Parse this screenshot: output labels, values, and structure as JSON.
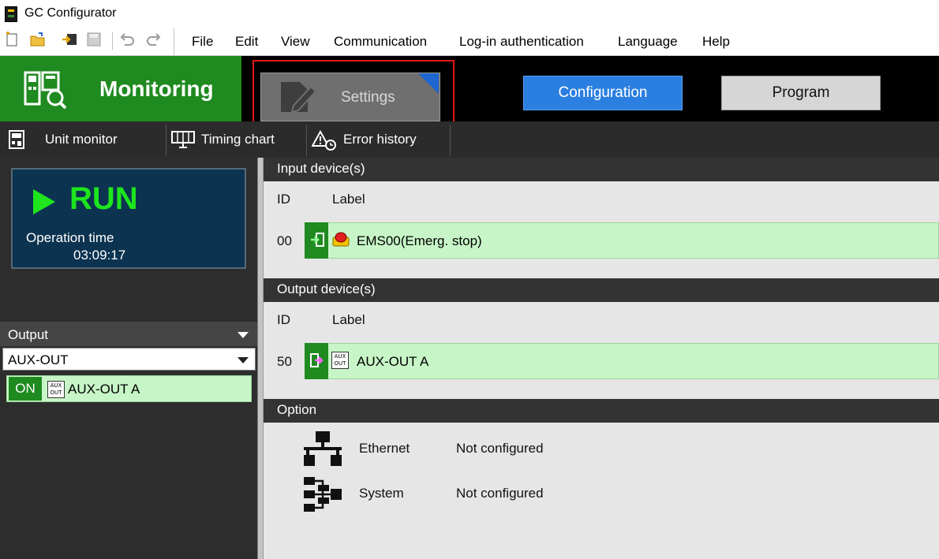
{
  "window": {
    "title": "GC Configurator"
  },
  "menu": {
    "items": [
      "File",
      "Edit",
      "View",
      "Communication",
      "Log-in authentication",
      "Language",
      "Help"
    ]
  },
  "toolbar_icons": [
    "new-file-icon",
    "open-folder-icon",
    "import-icon",
    "save-icon",
    "undo-icon",
    "redo-icon"
  ],
  "top_tabs": {
    "monitoring": "Monitoring",
    "settings": "Settings",
    "configuration": "Configuration",
    "program": "Program"
  },
  "sub_tabs": [
    "Unit monitor",
    "Timing chart",
    "Error history"
  ],
  "status": {
    "state": "RUN",
    "operation_time_label": "Operation time",
    "operation_time": "03:09:17"
  },
  "output_panel": {
    "header": "Output",
    "selected": "AUX-OUT",
    "items": [
      {
        "state": "ON",
        "icon_text": "AUX OUT",
        "label": "AUX-OUT A"
      }
    ]
  },
  "input_devices": {
    "header": "Input device(s)",
    "col_id": "ID",
    "col_label": "Label",
    "rows": [
      {
        "id": "00",
        "label": "EMS00(Emerg. stop)"
      }
    ]
  },
  "output_devices": {
    "header": "Output device(s)",
    "col_id": "ID",
    "col_label": "Label",
    "rows": [
      {
        "id": "50",
        "icon_text": "AUX OUT",
        "label": "AUX-OUT A"
      }
    ]
  },
  "options": {
    "header": "Option",
    "items": [
      {
        "name": "Ethernet",
        "status": "Not configured"
      },
      {
        "name": "System",
        "status": "Not configured"
      }
    ]
  },
  "colors": {
    "monitoring_green": "#1f8a1f",
    "run_green": "#1ee51e",
    "configuration_blue": "#2b7fe0",
    "highlight_red": "#e01818",
    "row_green": "#c7f5c7"
  }
}
